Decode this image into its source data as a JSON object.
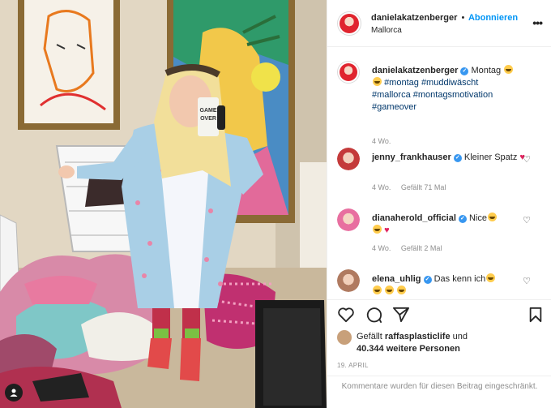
{
  "post": {
    "username": "danielakatzenberger",
    "follow_label": "Abonnieren",
    "location": "Mallorca",
    "more_icon": "more-horizontal-icon"
  },
  "caption": {
    "username": "danielakatzenberger",
    "text_start": "Montag",
    "tags": [
      "#montag",
      "#muddiwäscht",
      "#mallorca",
      "#montagsmotivation",
      "#gameover"
    ],
    "age": "4 Wo."
  },
  "comments": [
    {
      "username": "jenny_frankhauser",
      "text": "Kleiner Spatz",
      "age": "4 Wo.",
      "likes": "Gefällt 71 Mal",
      "avatar_color": "#c43a3a"
    },
    {
      "username": "dianaherold_official",
      "text": "Nice",
      "age": "4 Wo.",
      "likes": "Gefällt 2 Mal",
      "avatar_color": "#e86fa0"
    },
    {
      "username": "elena_uhlig",
      "text": "Das kenn ich",
      "avatar_color": "#b07a60"
    }
  ],
  "actions": {
    "liked_by_prefix": "Gefällt",
    "liked_by_user": "raffasplasticlife",
    "liked_by_joiner": "und",
    "others": "40.344 weitere Personen",
    "date": "19. APRIL"
  },
  "footer": {
    "comments_restricted": "Kommentare wurden für diesen Beitrag eingeschränkt."
  },
  "mug_text": "GAME OVER",
  "colors": {
    "accent": "#0095f6",
    "verified": "#3897f0",
    "avatar_red": "#e0242e"
  }
}
